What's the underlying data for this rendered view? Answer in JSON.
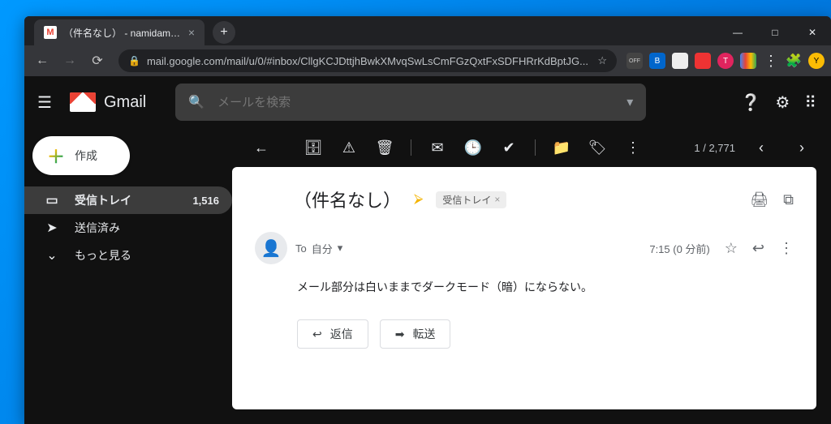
{
  "browser": {
    "tab_title": "（件名なし） - namidamelife@g",
    "url": "mail.google.com/mail/u/0/#inbox/CllgKCJDttjhBwkXMvqSwLsCmFGzQxtFxSDFHRrKdBptJG..."
  },
  "header": {
    "product": "Gmail",
    "search_placeholder": "メールを検索"
  },
  "sidebar": {
    "compose": "作成",
    "items": [
      {
        "icon": "inbox",
        "label": "受信トレイ",
        "count": "1,516",
        "active": true
      },
      {
        "icon": "send",
        "label": "送信済み",
        "count": "",
        "active": false
      },
      {
        "icon": "more",
        "label": "もっと見る",
        "count": "",
        "active": false
      }
    ]
  },
  "toolbar": {
    "position": "1 / 2,771"
  },
  "mail": {
    "subject": "（件名なし）",
    "label": "受信トレイ",
    "to_prefix": "To",
    "to_value": "自分",
    "time": "7:15 (0 分前)",
    "body": "メール部分は白いままでダークモード（暗）にならない。",
    "reply": "返信",
    "forward": "転送"
  }
}
